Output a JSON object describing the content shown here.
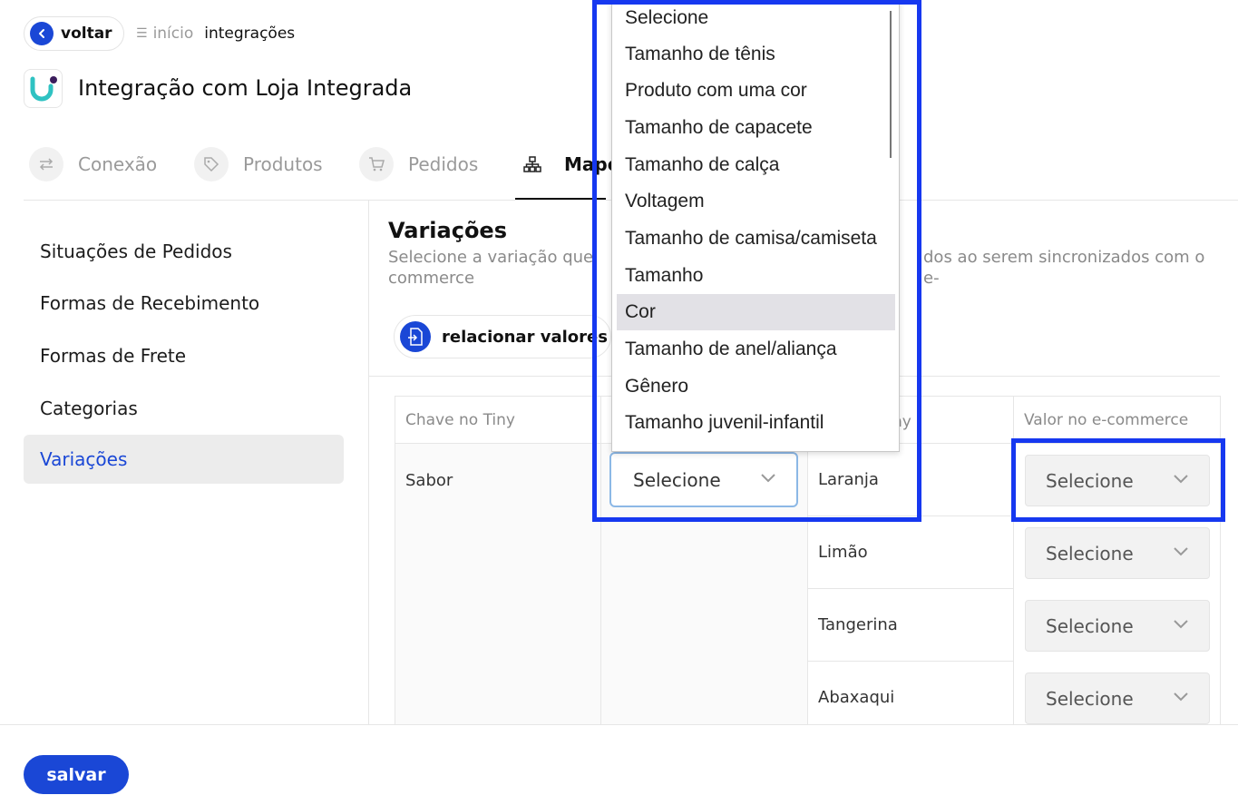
{
  "header": {
    "back_label": "voltar",
    "breadcrumb": {
      "home": "início",
      "current": "integrações"
    },
    "page_title": "Integração com Loja Integrada"
  },
  "tabs": [
    {
      "label": "Conexão",
      "icon": "arrows-icon"
    },
    {
      "label": "Produtos",
      "icon": "tag-icon"
    },
    {
      "label": "Pedidos",
      "icon": "cart-icon"
    },
    {
      "label": "Mape",
      "icon": "sitemap-icon",
      "active": true
    }
  ],
  "sidebar": {
    "items": [
      {
        "label": "Situações de Pedidos"
      },
      {
        "label": "Formas de Recebimento"
      },
      {
        "label": "Formas de Frete"
      },
      {
        "label": "Categorias"
      },
      {
        "label": "Variações",
        "active": true
      }
    ]
  },
  "main": {
    "title": "Variações",
    "description": "Selecione a variação que",
    "description_right": "dos ao serem sincronizados com o e-",
    "description_line2": "commerce",
    "relate_button": "relacionar valores p",
    "table": {
      "headers": [
        "Chave no Tiny",
        "",
        "ny",
        "Valor no e-commerce"
      ],
      "key": "Sabor",
      "variation_select": "Selecione",
      "rows": [
        {
          "tiny_value": "Laranja",
          "ecommerce_value": "Selecione"
        },
        {
          "tiny_value": "Limão",
          "ecommerce_value": "Selecione"
        },
        {
          "tiny_value": "Tangerina",
          "ecommerce_value": "Selecione"
        },
        {
          "tiny_value": "Abaxaqui",
          "ecommerce_value": "Selecione"
        }
      ]
    }
  },
  "dropdown": {
    "options": [
      "Selecione",
      "Tamanho de tênis",
      "Produto com uma cor",
      "Tamanho de capacete",
      "Tamanho de calça",
      "Voltagem",
      "Tamanho de camisa/camiseta",
      "Tamanho",
      "Cor",
      "Tamanho de anel/aliança",
      "Gênero",
      "Tamanho juvenil-infantil"
    ],
    "highlighted": "Cor"
  },
  "footer": {
    "save_label": "salvar"
  },
  "colors": {
    "accent": "#1a47d6",
    "highlight_box": "#1638f0"
  }
}
